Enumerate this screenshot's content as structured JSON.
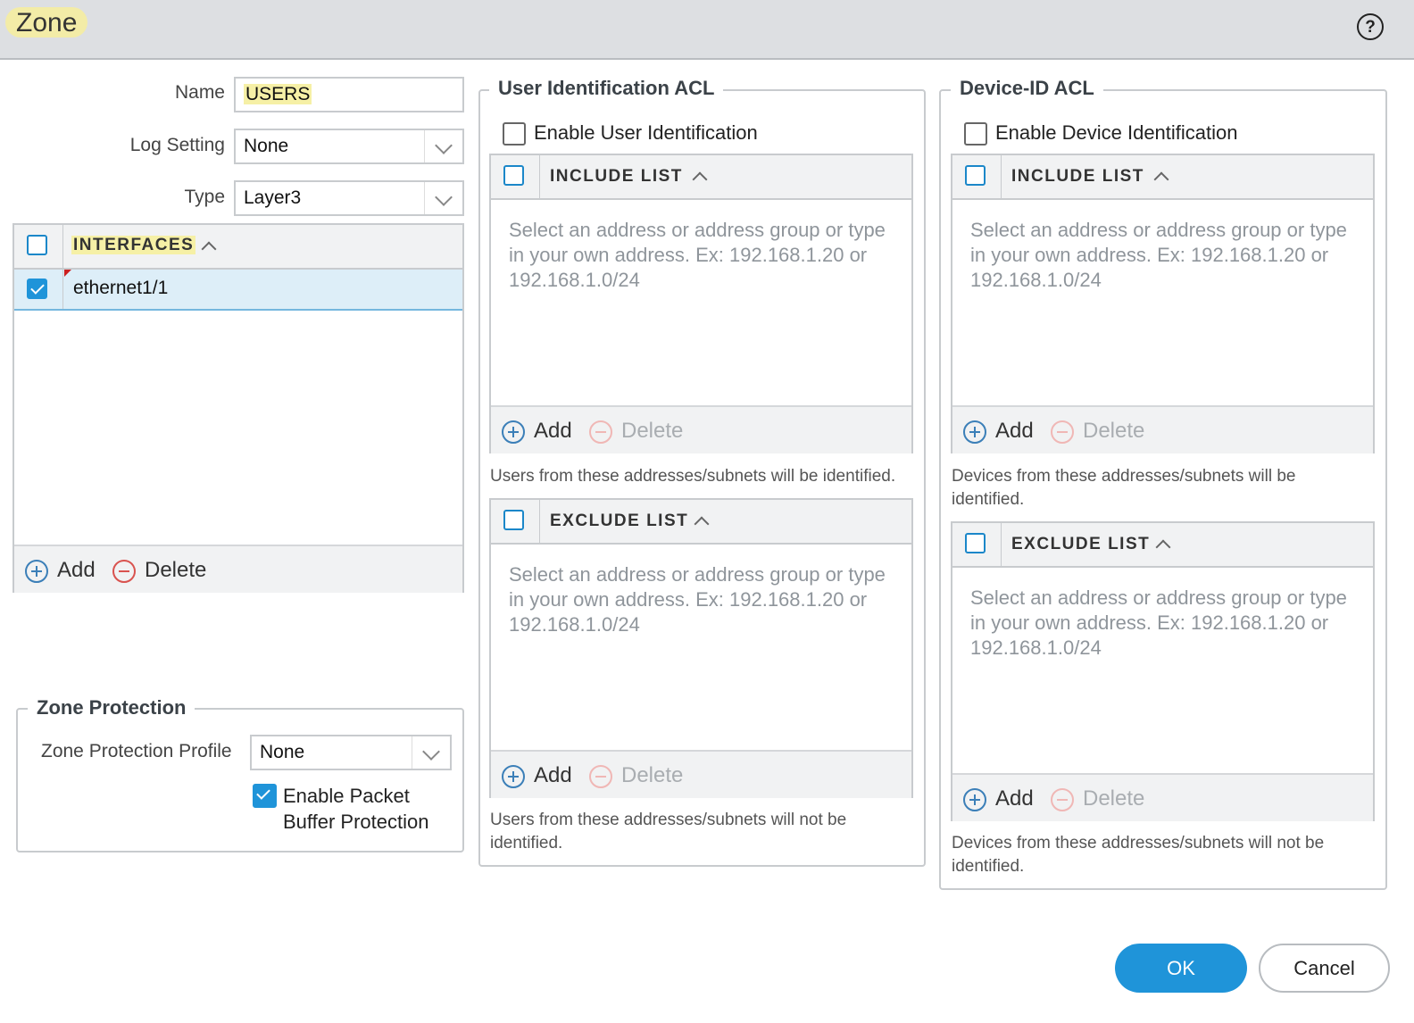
{
  "dialog": {
    "title": "Zone",
    "help_icon": "question-circle-icon"
  },
  "form": {
    "name_label": "Name",
    "name_value": "USERS",
    "log_setting_label": "Log Setting",
    "log_setting_value": "None",
    "type_label": "Type",
    "type_value": "Layer3"
  },
  "interfaces": {
    "header": "INTERFACES",
    "rows": [
      "ethernet1/1"
    ],
    "add_label": "Add",
    "delete_label": "Delete"
  },
  "zone_protection": {
    "legend": "Zone Protection",
    "profile_label": "Zone Protection Profile",
    "profile_value": "None",
    "packet_buffer_line1": "Enable Packet",
    "packet_buffer_line2": "Buffer Protection"
  },
  "user_acl": {
    "legend": "User Identification ACL",
    "enable_label": "Enable User Identification",
    "include_header": "INCLUDE LIST",
    "include_placeholder_l1": "Select an address or address group or type",
    "include_placeholder_l2": "in your own address. Ex: 192.168.1.20 or",
    "include_placeholder_l3": "192.168.1.0/24",
    "include_note": "Users from these addresses/subnets will be identified.",
    "exclude_header": "EXCLUDE LIST",
    "exclude_placeholder_l1": "Select an address or address group or type",
    "exclude_placeholder_l2": "in your own address. Ex: 192.168.1.20 or",
    "exclude_placeholder_l3": "192.168.1.0/24",
    "exclude_note_l1": "Users from these addresses/subnets will not be",
    "exclude_note_l2": "identified.",
    "add_label": "Add",
    "delete_label": "Delete"
  },
  "device_acl": {
    "legend": "Device-ID ACL",
    "enable_label": "Enable Device Identification",
    "include_header": "INCLUDE LIST",
    "include_placeholder_l1": "Select an address or address group or type",
    "include_placeholder_l2": "in your own address. Ex: 192.168.1.20 or",
    "include_placeholder_l3": "192.168.1.0/24",
    "include_note_l1": "Devices from these addresses/subnets will be",
    "include_note_l2": "identified.",
    "exclude_header": "EXCLUDE LIST",
    "exclude_placeholder_l1": "Select an address or address group or type",
    "exclude_placeholder_l2": "in your own address. Ex: 192.168.1.20 or",
    "exclude_placeholder_l3": "192.168.1.0/24",
    "exclude_note_l1": "Devices from these addresses/subnets will not be",
    "exclude_note_l2": "identified.",
    "add_label": "Add",
    "delete_label": "Delete"
  },
  "footer": {
    "ok_label": "OK",
    "cancel_label": "Cancel"
  },
  "colors": {
    "accent": "#1f94d9",
    "highlight": "#f6f0a6",
    "header_bg": "#dddfe2"
  }
}
